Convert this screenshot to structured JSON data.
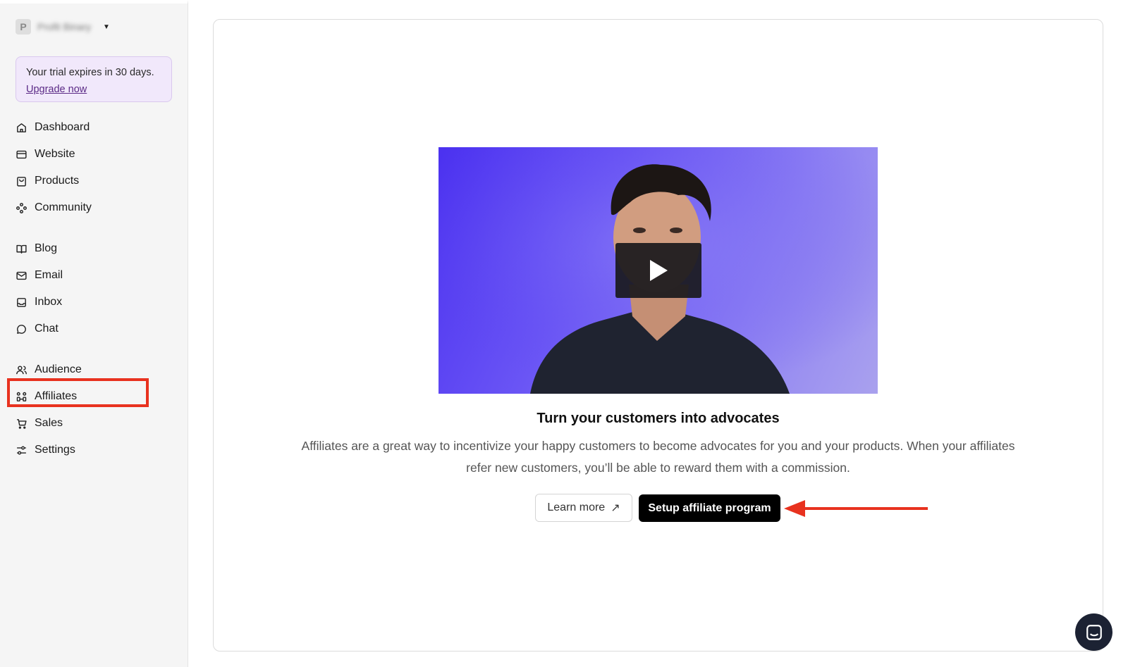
{
  "workspace": {
    "avatar_letter": "P",
    "name": "Profit Binary"
  },
  "trial": {
    "text": "Your trial expires in 30 days.",
    "link": "Upgrade now"
  },
  "nav": {
    "group1": [
      {
        "label": "Dashboard",
        "icon": "home-icon"
      },
      {
        "label": "Website",
        "icon": "browser-icon"
      },
      {
        "label": "Products",
        "icon": "bag-icon"
      },
      {
        "label": "Community",
        "icon": "community-icon"
      }
    ],
    "group2": [
      {
        "label": "Blog",
        "icon": "book-icon"
      },
      {
        "label": "Email",
        "icon": "mail-icon"
      },
      {
        "label": "Inbox",
        "icon": "inbox-icon"
      },
      {
        "label": "Chat",
        "icon": "chat-icon"
      }
    ],
    "group3": [
      {
        "label": "Audience",
        "icon": "users-icon"
      },
      {
        "label": "Affiliates",
        "icon": "affiliates-icon"
      },
      {
        "label": "Sales",
        "icon": "cart-icon"
      },
      {
        "label": "Settings",
        "icon": "sliders-icon"
      }
    ]
  },
  "main": {
    "headline": "Turn your customers into advocates",
    "description": "Affiliates are a great way to incentivize your happy customers to become advocates for you and your products. When your affiliates refer new customers, you’ll be able to reward them with a commission.",
    "learn_more": "Learn more",
    "learn_more_icon": "↗",
    "setup_button": "Setup affiliate program"
  },
  "colors": {
    "highlight": "#e8321f",
    "trial_bg": "#f1e8fb",
    "video_bg": "#6a55f5"
  }
}
